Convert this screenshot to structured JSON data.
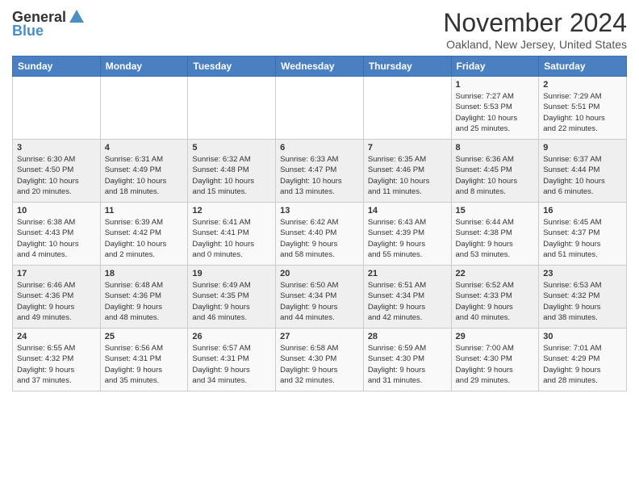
{
  "header": {
    "logo_general": "General",
    "logo_blue": "Blue",
    "month_title": "November 2024",
    "location": "Oakland, New Jersey, United States"
  },
  "days_of_week": [
    "Sunday",
    "Monday",
    "Tuesday",
    "Wednesday",
    "Thursday",
    "Friday",
    "Saturday"
  ],
  "weeks": [
    [
      {
        "day": "",
        "info": ""
      },
      {
        "day": "",
        "info": ""
      },
      {
        "day": "",
        "info": ""
      },
      {
        "day": "",
        "info": ""
      },
      {
        "day": "",
        "info": ""
      },
      {
        "day": "1",
        "info": "Sunrise: 7:27 AM\nSunset: 5:53 PM\nDaylight: 10 hours\nand 25 minutes."
      },
      {
        "day": "2",
        "info": "Sunrise: 7:29 AM\nSunset: 5:51 PM\nDaylight: 10 hours\nand 22 minutes."
      }
    ],
    [
      {
        "day": "3",
        "info": "Sunrise: 6:30 AM\nSunset: 4:50 PM\nDaylight: 10 hours\nand 20 minutes."
      },
      {
        "day": "4",
        "info": "Sunrise: 6:31 AM\nSunset: 4:49 PM\nDaylight: 10 hours\nand 18 minutes."
      },
      {
        "day": "5",
        "info": "Sunrise: 6:32 AM\nSunset: 4:48 PM\nDaylight: 10 hours\nand 15 minutes."
      },
      {
        "day": "6",
        "info": "Sunrise: 6:33 AM\nSunset: 4:47 PM\nDaylight: 10 hours\nand 13 minutes."
      },
      {
        "day": "7",
        "info": "Sunrise: 6:35 AM\nSunset: 4:46 PM\nDaylight: 10 hours\nand 11 minutes."
      },
      {
        "day": "8",
        "info": "Sunrise: 6:36 AM\nSunset: 4:45 PM\nDaylight: 10 hours\nand 8 minutes."
      },
      {
        "day": "9",
        "info": "Sunrise: 6:37 AM\nSunset: 4:44 PM\nDaylight: 10 hours\nand 6 minutes."
      }
    ],
    [
      {
        "day": "10",
        "info": "Sunrise: 6:38 AM\nSunset: 4:43 PM\nDaylight: 10 hours\nand 4 minutes."
      },
      {
        "day": "11",
        "info": "Sunrise: 6:39 AM\nSunset: 4:42 PM\nDaylight: 10 hours\nand 2 minutes."
      },
      {
        "day": "12",
        "info": "Sunrise: 6:41 AM\nSunset: 4:41 PM\nDaylight: 10 hours\nand 0 minutes."
      },
      {
        "day": "13",
        "info": "Sunrise: 6:42 AM\nSunset: 4:40 PM\nDaylight: 9 hours\nand 58 minutes."
      },
      {
        "day": "14",
        "info": "Sunrise: 6:43 AM\nSunset: 4:39 PM\nDaylight: 9 hours\nand 55 minutes."
      },
      {
        "day": "15",
        "info": "Sunrise: 6:44 AM\nSunset: 4:38 PM\nDaylight: 9 hours\nand 53 minutes."
      },
      {
        "day": "16",
        "info": "Sunrise: 6:45 AM\nSunset: 4:37 PM\nDaylight: 9 hours\nand 51 minutes."
      }
    ],
    [
      {
        "day": "17",
        "info": "Sunrise: 6:46 AM\nSunset: 4:36 PM\nDaylight: 9 hours\nand 49 minutes."
      },
      {
        "day": "18",
        "info": "Sunrise: 6:48 AM\nSunset: 4:36 PM\nDaylight: 9 hours\nand 48 minutes."
      },
      {
        "day": "19",
        "info": "Sunrise: 6:49 AM\nSunset: 4:35 PM\nDaylight: 9 hours\nand 46 minutes."
      },
      {
        "day": "20",
        "info": "Sunrise: 6:50 AM\nSunset: 4:34 PM\nDaylight: 9 hours\nand 44 minutes."
      },
      {
        "day": "21",
        "info": "Sunrise: 6:51 AM\nSunset: 4:34 PM\nDaylight: 9 hours\nand 42 minutes."
      },
      {
        "day": "22",
        "info": "Sunrise: 6:52 AM\nSunset: 4:33 PM\nDaylight: 9 hours\nand 40 minutes."
      },
      {
        "day": "23",
        "info": "Sunrise: 6:53 AM\nSunset: 4:32 PM\nDaylight: 9 hours\nand 38 minutes."
      }
    ],
    [
      {
        "day": "24",
        "info": "Sunrise: 6:55 AM\nSunset: 4:32 PM\nDaylight: 9 hours\nand 37 minutes."
      },
      {
        "day": "25",
        "info": "Sunrise: 6:56 AM\nSunset: 4:31 PM\nDaylight: 9 hours\nand 35 minutes."
      },
      {
        "day": "26",
        "info": "Sunrise: 6:57 AM\nSunset: 4:31 PM\nDaylight: 9 hours\nand 34 minutes."
      },
      {
        "day": "27",
        "info": "Sunrise: 6:58 AM\nSunset: 4:30 PM\nDaylight: 9 hours\nand 32 minutes."
      },
      {
        "day": "28",
        "info": "Sunrise: 6:59 AM\nSunset: 4:30 PM\nDaylight: 9 hours\nand 31 minutes."
      },
      {
        "day": "29",
        "info": "Sunrise: 7:00 AM\nSunset: 4:30 PM\nDaylight: 9 hours\nand 29 minutes."
      },
      {
        "day": "30",
        "info": "Sunrise: 7:01 AM\nSunset: 4:29 PM\nDaylight: 9 hours\nand 28 minutes."
      }
    ]
  ]
}
